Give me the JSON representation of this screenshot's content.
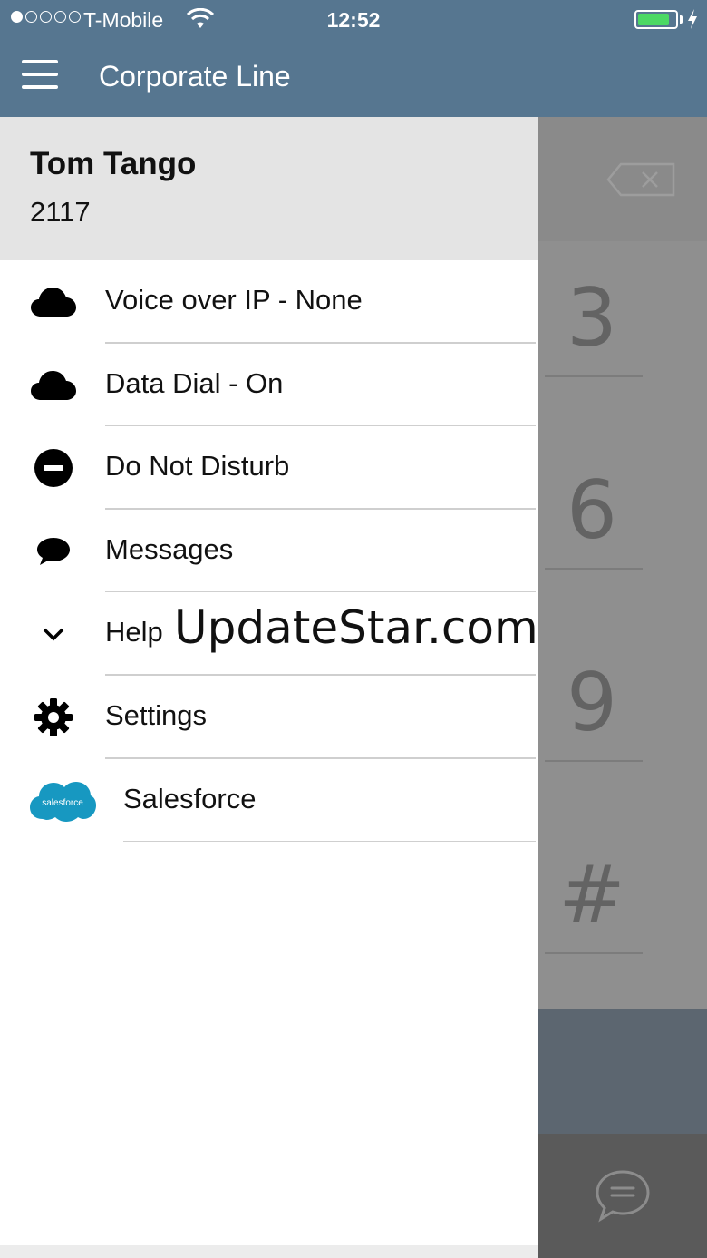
{
  "status_bar": {
    "carrier": "T-Mobile",
    "time": "12:52",
    "signal_bars": 1,
    "signal_total": 5,
    "battery_level": 0.85,
    "battery_color": "#4cd964"
  },
  "header": {
    "title": "Corporate Line",
    "background": "#567690"
  },
  "profile": {
    "name": "Tom Tango",
    "extension": "2117"
  },
  "menu": {
    "items": [
      {
        "label": "Voice over IP - None",
        "icon": "cloud-icon"
      },
      {
        "label": "Data Dial - On",
        "icon": "cloud-icon"
      },
      {
        "label": "Do Not Disturb",
        "icon": "do-not-disturb-icon"
      },
      {
        "label": "Messages",
        "icon": "speech-bubble-icon"
      },
      {
        "label": "Help",
        "icon": "chevron-down-icon"
      },
      {
        "label": "Settings",
        "icon": "gear-icon"
      },
      {
        "label": "Salesforce",
        "icon": "salesforce-logo"
      }
    ]
  },
  "salesforce_logo_text": "salesforce",
  "watermark": "UpdateStar.com",
  "dialer": {
    "keys": [
      "3",
      "6",
      "9",
      "#"
    ]
  }
}
